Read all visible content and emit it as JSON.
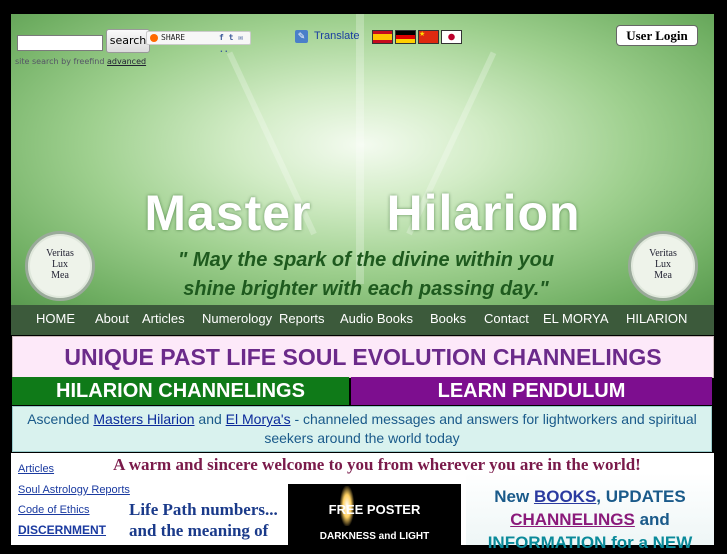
{
  "search": {
    "button_label": "search",
    "note": "site search by freefind",
    "advanced_label": "advanced"
  },
  "share": {
    "label": "SHARE",
    "services": "f t ✉ ..",
    "icon": "share-icon"
  },
  "translate": {
    "label": "Translate",
    "icon": "translate-icon",
    "flags": [
      "spain-flag",
      "germany-flag",
      "china-flag",
      "japan-flag"
    ]
  },
  "user_login": {
    "label": "User Login"
  },
  "header": {
    "title": "Master Hilarion",
    "tagline_line1": "\" May the spark of the divine within you",
    "tagline_line2": "shine brighter with each passing day.\"",
    "seal_lines": [
      "Veritas",
      "Lux",
      "Mea"
    ]
  },
  "nav": {
    "items": [
      {
        "label": "HOME"
      },
      {
        "label": "About"
      },
      {
        "label": "Articles"
      },
      {
        "label": "Numerology"
      },
      {
        "label": "Reports"
      },
      {
        "label": "Audio Books"
      },
      {
        "label": "Books"
      },
      {
        "label": "Contact"
      },
      {
        "label": "EL MORYA"
      },
      {
        "label": "HILARION"
      }
    ]
  },
  "main": {
    "soul_banner": "UNIQUE PAST LIFE SOUL EVOLUTION CHANNELINGS",
    "hilarion_button": "HILARION CHANNELINGS",
    "pendulum_button": "LEARN PENDULUM",
    "intro": {
      "part1": "Ascended ",
      "link1": "Masters Hilarion",
      "part2": " and ",
      "link2": "El Morya's",
      "part3": " - channeled messages and answers for lightworkers and spiritual seekers around the world today"
    },
    "welcome": "A warm and sincere welcome to you from wherever you are in the world!",
    "life_path": "Life Path numbers... and the meaning of",
    "poster": {
      "title": "FREE POSTER",
      "subtitle": "DARKNESS and LIGHT"
    },
    "news": {
      "part1": "New ",
      "link1": "BOOKS",
      "part2": ", UPDATES",
      "link2": "CHANNELINGS",
      "part3": " and",
      "part4": "INFORMATION for a NEW"
    }
  },
  "sidebar": {
    "links": [
      {
        "label": "Articles"
      },
      {
        "label": "Soul Astrology Reports"
      },
      {
        "label": "Code of Ethics"
      },
      {
        "label": "DISCERNMENT"
      }
    ]
  },
  "colors": {
    "nav_bg": "#3c5a3b",
    "hilarion_green": "#0f7a18",
    "pendulum_purple": "#7d0e8f",
    "soul_banner_text": "#6b2a8a"
  }
}
